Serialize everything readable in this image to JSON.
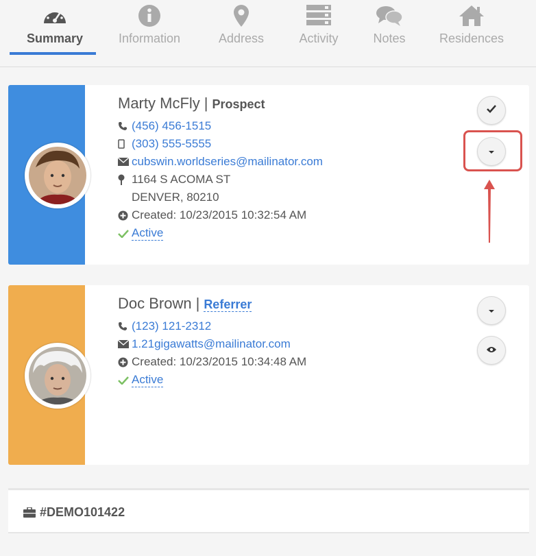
{
  "tabs": [
    {
      "label": "Summary",
      "icon": "dashboard-icon",
      "active": true
    },
    {
      "label": "Information",
      "icon": "info-icon"
    },
    {
      "label": "Address",
      "icon": "map-pin-icon"
    },
    {
      "label": "Activity",
      "icon": "server-icon"
    },
    {
      "label": "Notes",
      "icon": "chat-icon"
    },
    {
      "label": "Residences",
      "icon": "home-icon"
    }
  ],
  "contacts": [
    {
      "name": "Marty McFly",
      "role": "Prospect",
      "phone": "(456) 456-1515",
      "mobile": "(303) 555-5555",
      "email": "cubswin.worldseries@mailinator.com",
      "address_line1": "1164 S ACOMA ST",
      "address_line2": "DENVER, 80210",
      "created": "Created: 10/23/2015 10:32:54 AM",
      "status": "Active",
      "band_color": "#3f8ddf"
    },
    {
      "name": "Doc Brown",
      "role": "Referrer",
      "phone": "(123) 121-2312",
      "email": "1.21gigawatts@mailinator.com",
      "created": "Created: 10/23/2015 10:34:48 AM",
      "status": "Active",
      "band_color": "#f0ad4e"
    }
  ],
  "footer": {
    "id": "#DEMO101422"
  },
  "colors": {
    "accent": "#3a7bd5",
    "highlight": "#d9534f",
    "check": "#7cc063"
  }
}
